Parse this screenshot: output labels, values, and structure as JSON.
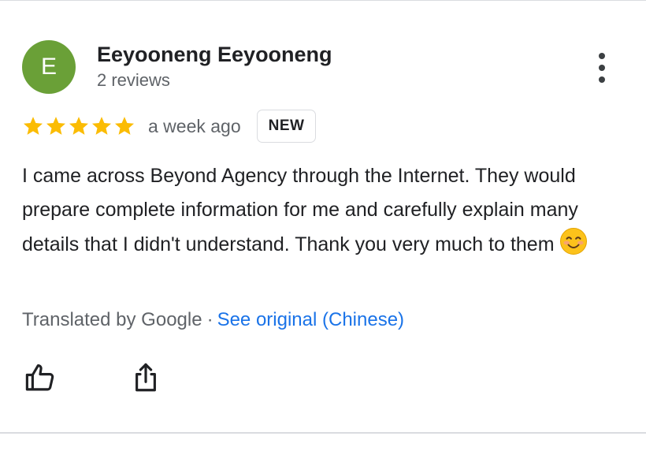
{
  "reviewer": {
    "initial": "E",
    "name": "Eeyooneng Eeyooneng",
    "review_count": "2 reviews"
  },
  "review": {
    "rating": 5,
    "time": "a week ago",
    "badge": "NEW",
    "text": "I came across Beyond Agency through the Internet. They would prepare complete information for me and carefully explain many details that I didn't understand. Thank you very much to them",
    "emoji": "smiling-face-emoji",
    "translated_by": "Translated by Google",
    "separator": "·",
    "see_original": "See original (Chinese)"
  },
  "actions": {
    "like_icon": "thumbs-up-icon",
    "share_icon": "share-icon",
    "menu_icon": "more-vertical-icon"
  },
  "colors": {
    "avatar": "#6aa037",
    "star": "#fbbc04",
    "link": "#1a73e8",
    "secondary_text": "#5f6368",
    "primary_text": "#202124",
    "divider": "#dadce0"
  }
}
